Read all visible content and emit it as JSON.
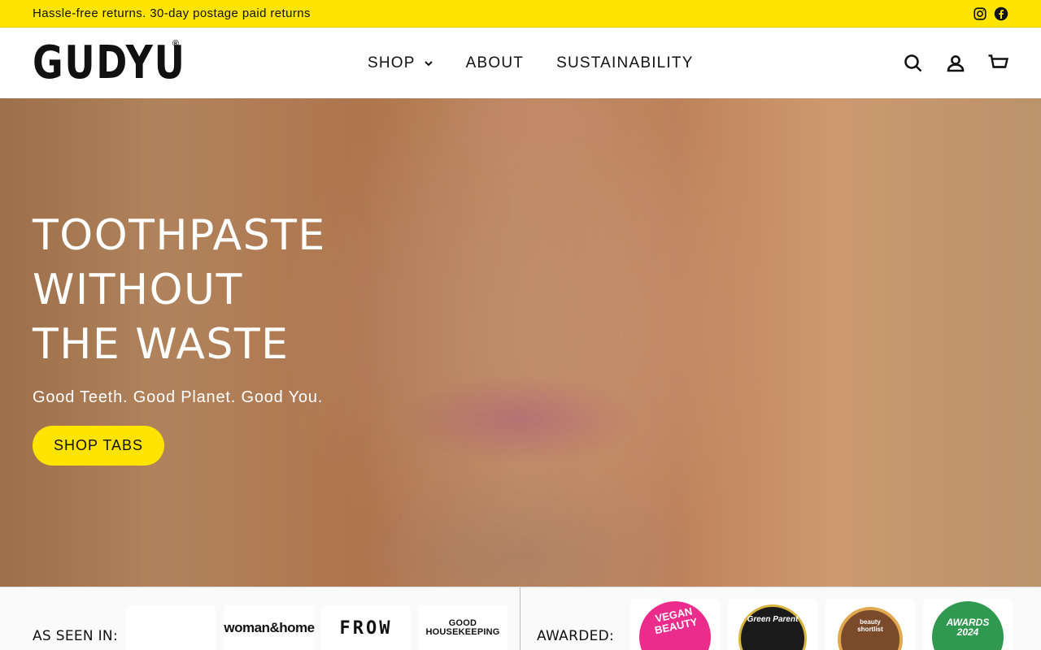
{
  "announcement": {
    "text": "Hassle-free returns. 30-day postage paid returns",
    "social": [
      "instagram-icon",
      "facebook-icon"
    ]
  },
  "header": {
    "logo": "GUDYU",
    "logo_mark": "®",
    "nav": [
      {
        "label": "SHOP",
        "has_dropdown": true
      },
      {
        "label": "ABOUT"
      },
      {
        "label": "SUSTAINABILITY"
      }
    ],
    "icons": [
      "search-icon",
      "account-icon",
      "cart-icon"
    ]
  },
  "hero": {
    "title_lines": [
      "TOOTHPASTE",
      "WITHOUT",
      "THE WASTE"
    ],
    "subtitle": "Good Teeth. Good Planet. Good You.",
    "cta": "SHOP TABS"
  },
  "press": {
    "label": "AS SEEN IN:",
    "logos": [
      "",
      "woman&home",
      "FROW",
      "GOOD HOUSEKEEPING"
    ]
  },
  "awards": {
    "label": "AWARDED:",
    "badges": [
      {
        "name": "Vegan Beauty Award Winner",
        "text": "VEGAN BEAUTY",
        "color": "#ec2c8c"
      },
      {
        "name": "The Green Parent Natural Beauty Awards Gold",
        "text": "Green Parent",
        "color": "#1b1b1b"
      },
      {
        "name": "Beauty Shortlist Baby Awards Winner",
        "text": "beauty shortlist",
        "color": "#7a4a2a"
      },
      {
        "name": "Beauty Shortlist Awards 2024",
        "text": "AWARDS 2024",
        "color": "#2f9a4f"
      }
    ]
  },
  "colors": {
    "accent": "#ffe400",
    "text": "#111111"
  }
}
